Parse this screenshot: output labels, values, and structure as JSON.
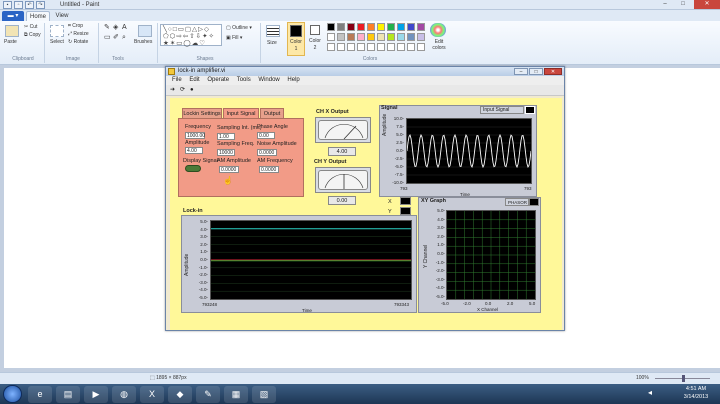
{
  "app": {
    "title": "Untitled - Paint"
  },
  "ribbon": {
    "tabs": [
      "Home",
      "View"
    ],
    "clipboard": {
      "paste": "Paste",
      "cut": "Cut",
      "copy": "Copy",
      "group": "Clipboard"
    },
    "image": {
      "select": "Select",
      "crop": "Crop",
      "resize": "Resize",
      "rotate": "Rotate",
      "group": "Image"
    },
    "tools": {
      "group": "Tools"
    },
    "shapes": {
      "brushes": "Brushes",
      "outline": "Outline",
      "fill": "Fill",
      "group": "Shapes"
    },
    "size": "Size",
    "color1": "Color\n1",
    "color2": "Color\n2",
    "edit_colors": "Edit colors",
    "colors_group": "Colors",
    "palette": [
      "#000000",
      "#7f7f7f",
      "#880015",
      "#ed1c24",
      "#ff7f27",
      "#fff200",
      "#22b14c",
      "#00a2e8",
      "#3f48cc",
      "#a349a4",
      "#ffffff",
      "#c3c3c3",
      "#b97a57",
      "#ffaec9",
      "#ffc90e",
      "#efe4b0",
      "#b5e61d",
      "#99d9ea",
      "#7092be",
      "#c8bfe7"
    ]
  },
  "vi": {
    "title": "lock-in amplifier.vi",
    "menu": [
      "File",
      "Edit",
      "Operate",
      "Tools",
      "Window",
      "Help"
    ],
    "tabs": [
      "Lockin Settings",
      "Input Signal",
      "Output"
    ],
    "frequency_label": "Frequency",
    "frequency_value": "1000.00",
    "sampling_int_label": "Sampling Int. (ms)",
    "sampling_int_value": "1.00",
    "phase_angle_label": "Phase Angle",
    "phase_angle_value": "0.00",
    "amplitude_label": "Amplitude",
    "amplitude_value": "4.00",
    "sampling_freq_label": "Sampling Freq.",
    "sampling_freq_value": "10000",
    "noise_amp_label": "Noise Amplitude",
    "noise_amp_value": "0.0000",
    "display_signal_label": "Display Signal",
    "am_amplitude_label": "AM Amplitude",
    "am_amplitude_value": "0.0000",
    "am_frequency_label": "AM Frequency",
    "am_frequency_value": "0.0000",
    "chx_label": "CH X Output",
    "chx_value": "4.00",
    "chy_label": "CH Y Output",
    "chy_value": "0.00",
    "signal_label": "Signal",
    "input_signal_legend": "Input Signal",
    "signal_yticks": [
      "10.0-",
      "7.5-",
      "5.0-",
      "2.5-",
      "0.0-",
      "-2.5-",
      "-5.0-",
      "-7.5-",
      "-10.0-"
    ],
    "signal_ylabel": "Amplitude",
    "signal_xmin": "793",
    "signal_xmax": "793",
    "signal_xlabel": "Time",
    "xy_graph_label": "XY Graph",
    "phasor_legend": "PHASOR",
    "x_label": "X",
    "y_label": "Y",
    "xy_yticks": [
      "5.0-",
      "4.0-",
      "3.0-",
      "2.0-",
      "1.0-",
      "0.0-",
      "-1.0-",
      "-2.0-",
      "-3.0-",
      "-4.0-",
      "-5.0-"
    ],
    "xy_xticks": [
      "-5.0",
      "-2.0",
      "0.0",
      "2.0",
      "5.0"
    ],
    "xy_ylabel": "Y Channel",
    "xy_xlabel": "X Channel",
    "lockin_label": "Lock-in",
    "lockin_yticks": [
      "5.0-",
      "4.0-",
      "3.0-",
      "2.0-",
      "1.0-",
      "0.0-",
      "-1.0-",
      "-2.0-",
      "-3.0-",
      "-4.0-",
      "-5.0-"
    ],
    "lockin_ylabel": "Amplitude",
    "lockin_xmin": "793248",
    "lockin_xmax": "793343",
    "lockin_xlabel": "Time"
  },
  "status": {
    "dimensions": "1895 × 887px",
    "zoom": "100%"
  },
  "taskbar": {
    "time": "4:51 AM",
    "date": "3/14/2013"
  }
}
